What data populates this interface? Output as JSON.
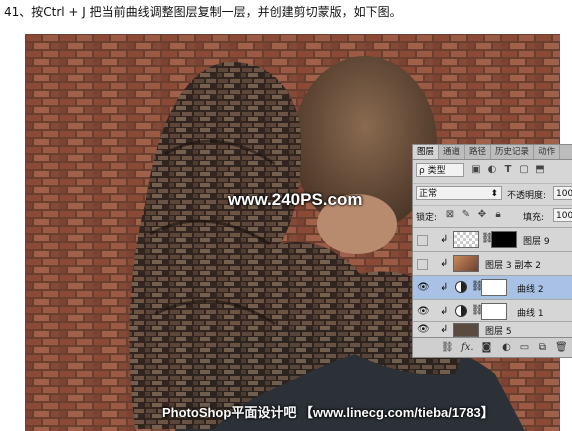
{
  "caption": "41、按Ctrl + J 把当前曲线调整图层复制一层，并创建剪切蒙版，如下图。",
  "watermark": "www.240PS.com",
  "footer_credit": "PhotoShop平面设计吧 【www.linecg.com/tieba/1783】",
  "panel": {
    "tabs": [
      "图层",
      "通道",
      "路径",
      "历史记录",
      "动作"
    ],
    "active_tab": 0,
    "filter": {
      "label": "ρ 类型",
      "icons": [
        "image-filter-icon",
        "adjustment-filter-icon",
        "type-filter-icon",
        "shape-filter-icon",
        "smart-object-filter-icon"
      ]
    },
    "blend_mode": "正常",
    "opacity_label": "不透明度:",
    "opacity_value": "100%",
    "lock_label": "锁定:",
    "fill_label": "填充:",
    "fill_value": "100%",
    "layers": [
      {
        "name": "图层 9",
        "visible": false,
        "clipped": true,
        "selected": false,
        "kind": "pixel-with-mask"
      },
      {
        "name": "图层 3 副本 2",
        "visible": false,
        "clipped": true,
        "selected": false,
        "kind": "pixel"
      },
      {
        "name": "曲线 2",
        "visible": true,
        "clipped": true,
        "selected": true,
        "kind": "curves"
      },
      {
        "name": "曲线 1",
        "visible": true,
        "clipped": true,
        "selected": false,
        "kind": "curves"
      },
      {
        "name": "图层 5",
        "visible": true,
        "clipped": true,
        "selected": false,
        "kind": "pixel"
      }
    ],
    "bottom_icons": [
      "link-icon",
      "fx-icon",
      "add-mask-icon",
      "new-adjustment-icon",
      "new-group-icon",
      "new-layer-icon",
      "delete-icon"
    ],
    "bottom_fx": "fx."
  },
  "colors": {
    "selected_layer": "#a9c1e4",
    "panel_bg": "#d6d6d6"
  }
}
